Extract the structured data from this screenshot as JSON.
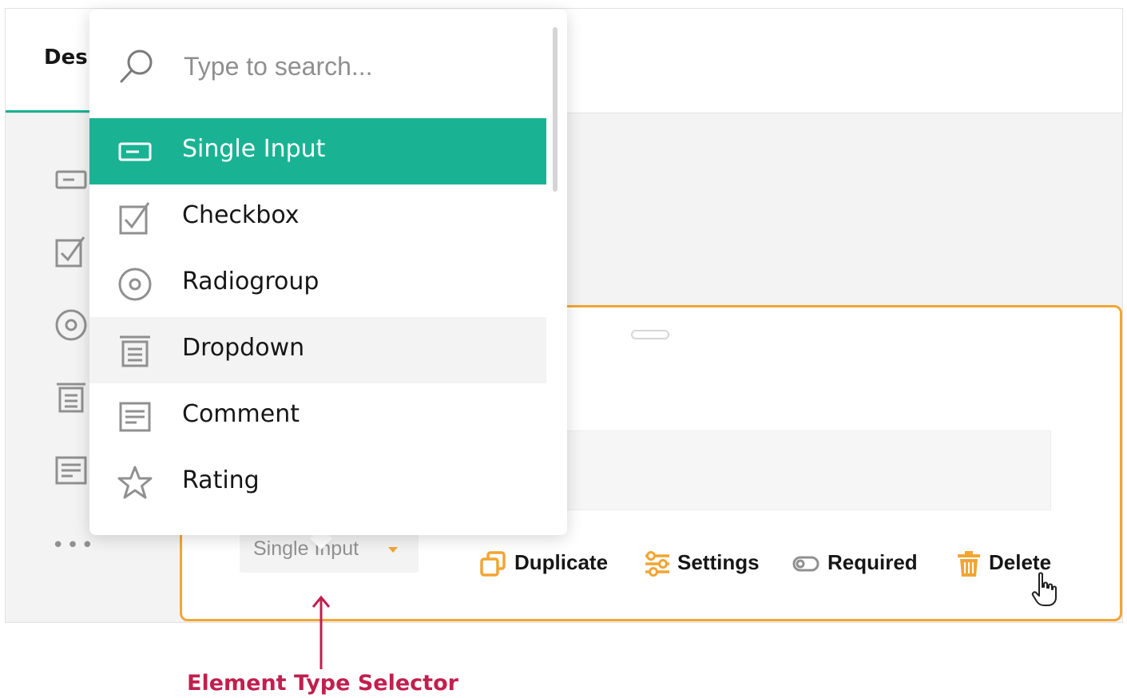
{
  "designer_tab": {
    "label": "Des"
  },
  "question_card": {
    "type_selector": {
      "selected": "Single Input"
    },
    "actions": {
      "duplicate": "Duplicate",
      "settings": "Settings",
      "required": "Required",
      "delete": "Delete"
    }
  },
  "toolbox": {
    "icons": [
      "single-input-icon",
      "checkbox-icon",
      "radiogroup-icon",
      "dropdown-icon",
      "comment-icon"
    ],
    "more": "•••"
  },
  "dropdown_menu": {
    "search_placeholder": "Type to search...",
    "items": [
      {
        "label": "Single Input",
        "icon": "single-input-icon",
        "state": "selected"
      },
      {
        "label": "Checkbox",
        "icon": "checkbox-icon"
      },
      {
        "label": "Radiogroup",
        "icon": "radiogroup-icon"
      },
      {
        "label": "Dropdown",
        "icon": "dropdown-icon",
        "state": "hovered"
      },
      {
        "label": "Comment",
        "icon": "comment-icon"
      },
      {
        "label": "Rating",
        "icon": "star-icon"
      }
    ]
  },
  "annotation": {
    "caption": "Element Type Selector"
  },
  "colors": {
    "accent": "#19b394",
    "card_border": "#f2a533",
    "caption": "#c0204f",
    "icon_gray": "#909090"
  }
}
